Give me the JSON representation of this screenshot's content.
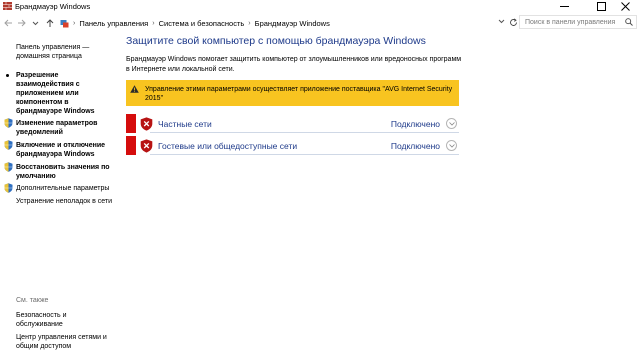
{
  "window": {
    "title": "Брандмауэр Windows"
  },
  "address": {
    "crumbs": [
      "Панель управления",
      "Система и безопасность",
      "Брандмауэр Windows"
    ],
    "search_placeholder": "Поиск в панели управления"
  },
  "sidebar": {
    "home_line1": "Панель управления —",
    "home_line2": "домашняя страница",
    "items": [
      {
        "lines": [
          "Разрешение",
          "взаимодействия с",
          "приложением или",
          "компонентом в",
          "брандмауэре Windows"
        ]
      },
      {
        "lines": [
          "Изменение параметров",
          "уведомлений"
        ]
      },
      {
        "lines": [
          "Включение и отключение",
          "брандмауэра Windows"
        ]
      },
      {
        "lines": [
          "Восстановить значения по",
          "умолчанию"
        ]
      },
      {
        "lines": [
          "Дополнительные параметры"
        ]
      },
      {
        "lines": [
          "Устранение неполадок в сети"
        ]
      }
    ],
    "see_also": "См. также",
    "see_items": [
      {
        "lines": [
          "Безопасность и",
          "обслуживание"
        ]
      },
      {
        "lines": [
          "Центр управления сетями и",
          "общим доступом"
        ]
      }
    ]
  },
  "main": {
    "heading": "Защитите свой компьютер с помощью брандмауэра Windows",
    "description_line1": "Брандмауэр Windows помогает защитить компьютер от злоумышленников или вредоносных программ",
    "description_line2": "в Интернете или локальной сети.",
    "warning_line1": "Управление этими параметрами осуществляет приложение поставщика \"AVG Internet Security",
    "warning_line2": "2015\"",
    "networks": [
      {
        "name": "Частные сети",
        "status": "Подключено"
      },
      {
        "name": "Гостевые или общедоступные сети",
        "status": "Подключено"
      }
    ]
  },
  "colors": {
    "accent_blue": "#1e3a8a",
    "warning_yellow": "#f8c420",
    "danger_red": "#d50d0d"
  }
}
